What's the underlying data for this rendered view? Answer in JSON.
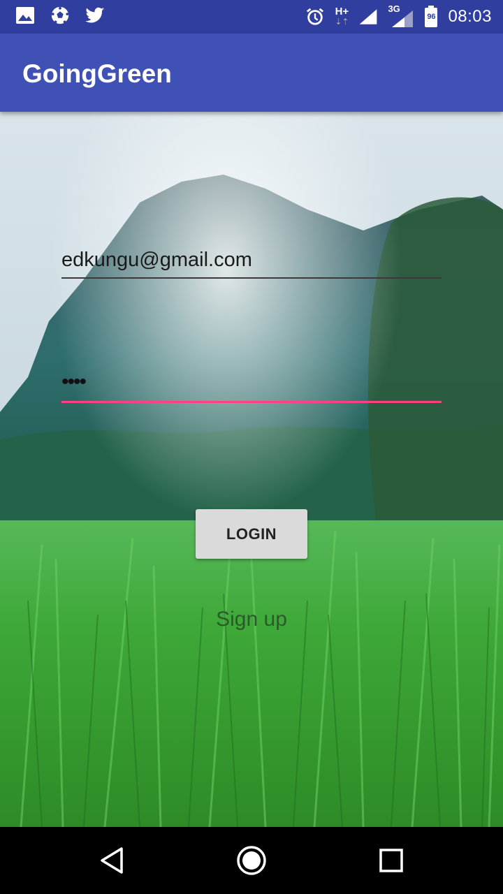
{
  "status_bar": {
    "time": "08:03",
    "network_label": "H+",
    "network_label_2": "3G",
    "battery": "96",
    "icons": [
      "image-icon",
      "soccer-icon",
      "twitter-icon",
      "alarm-icon",
      "signal-icon",
      "signal-3g-icon",
      "battery-icon"
    ]
  },
  "app_bar": {
    "title": "GoingGreen"
  },
  "form": {
    "email_value": "edkungu@gmail.com",
    "password_value": "••••",
    "login_label": "LOGIN",
    "signup_label": "Sign up"
  },
  "nav_bar": {
    "icons": [
      "back-icon",
      "home-icon",
      "recents-icon"
    ]
  },
  "colors": {
    "primary": "#3F51B5",
    "primary_dark": "#303F9F",
    "accent": "#FF4081"
  }
}
